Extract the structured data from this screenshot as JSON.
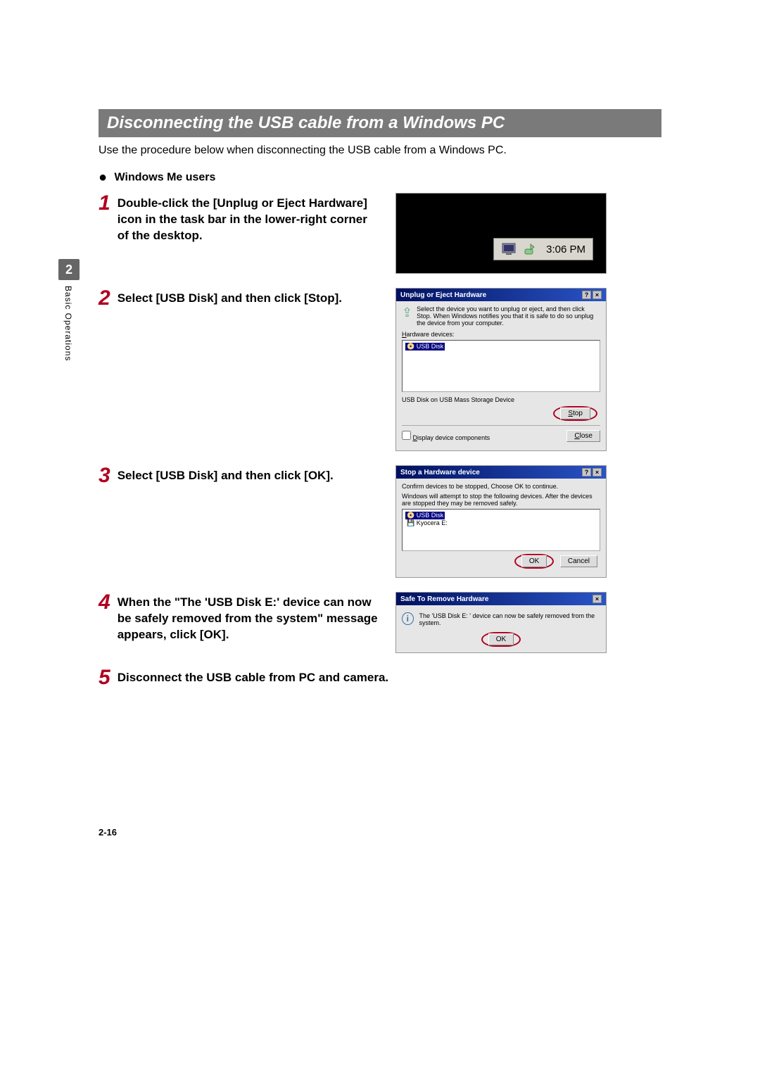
{
  "side": {
    "chapter": "2",
    "label": "Basic Operations"
  },
  "title": "Disconnecting the USB cable from a Windows PC",
  "intro": "Use the procedure below when disconnecting the USB cable from a Windows PC.",
  "bullet1": "Windows Me users",
  "steps": {
    "s1": {
      "num": "1",
      "text": "Double-click the [Unplug or Eject Hardware] icon in the task bar in the lower-right corner of the desktop."
    },
    "s2": {
      "num": "2",
      "text": "Select [USB Disk] and then click [Stop]."
    },
    "s3": {
      "num": "3",
      "text": "Select [USB Disk] and then click [OK]."
    },
    "s4": {
      "num": "4",
      "text": "When the \"The 'USB Disk E:' device can now be safely removed from the system\" message appears, click [OK]."
    },
    "s5": {
      "num": "5",
      "text": "Disconnect the USB cable from PC and camera."
    }
  },
  "fig1": {
    "time": "3:06 PM"
  },
  "fig2": {
    "title": "Unplug or Eject Hardware",
    "help": "?",
    "close": "×",
    "msg": "Select the device you want to unplug or eject, and then click Stop. When Windows notifies you that it is safe to do so unplug the device from your computer.",
    "listLabel": "Hardware devices:",
    "item": "USB Disk",
    "detail": "USB Disk on USB Mass Storage Device",
    "stop": "Stop",
    "chk": "Display device components",
    "closeBtn": "Close"
  },
  "fig3": {
    "title": "Stop a Hardware device",
    "msg1": "Confirm devices to be stopped, Choose OK to continue.",
    "msg2": "Windows will attempt to stop the following devices. After the devices are stopped they may be removed safely.",
    "item1": "USB Disk",
    "item2": "Kyocera E:",
    "ok": "OK",
    "cancel": "Cancel"
  },
  "fig4": {
    "title": "Safe To Remove Hardware",
    "msg": "The 'USB Disk E: ' device can now be safely removed from the system.",
    "ok": "OK"
  },
  "pageNum": "2-16"
}
